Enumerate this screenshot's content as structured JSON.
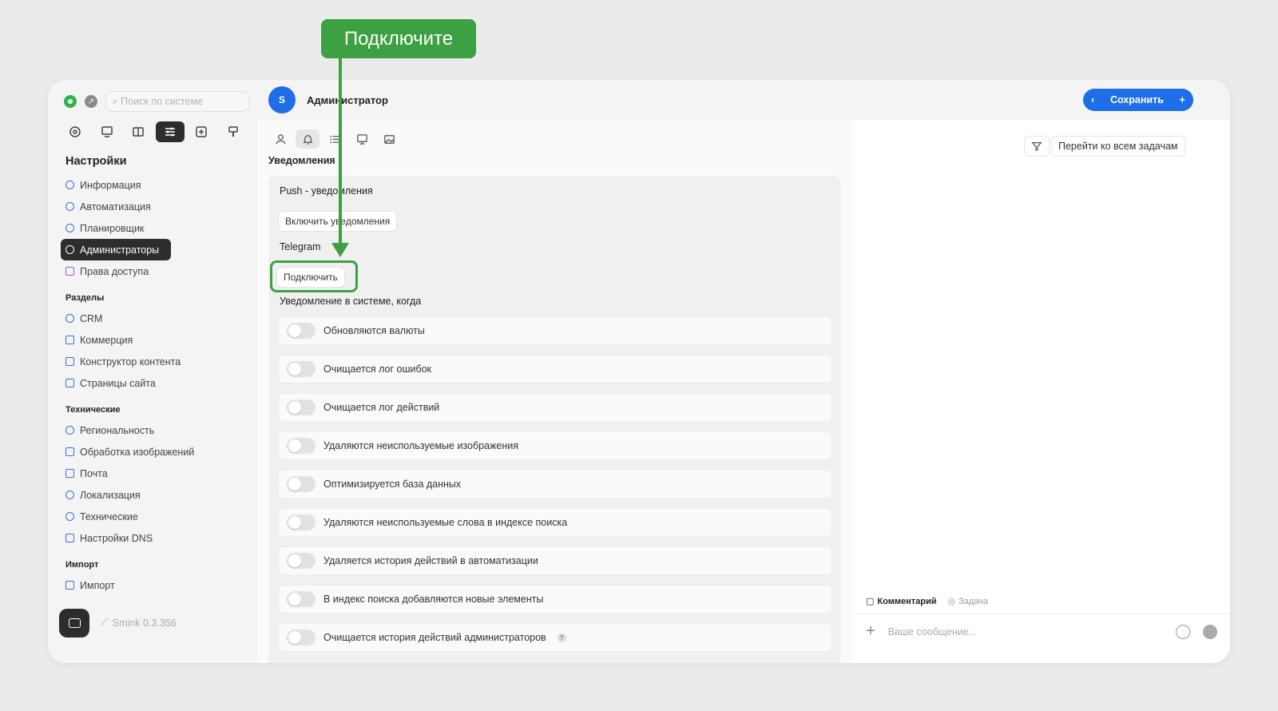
{
  "callout": {
    "text": "Подключите"
  },
  "search": {
    "placeholder": "Поиск по системе"
  },
  "sidebar": {
    "title": "Настройки",
    "settings_items": [
      {
        "label": "Информация"
      },
      {
        "label": "Автоматизация"
      },
      {
        "label": "Планировщик"
      },
      {
        "label": "Администраторы",
        "active": true
      },
      {
        "label": "Права доступа"
      }
    ],
    "sections": [
      {
        "title": "Разделы",
        "items": [
          "CRM",
          "Коммерция",
          "Конструктор контента",
          "Страницы сайта"
        ]
      },
      {
        "title": "Технические",
        "items": [
          "Региональность",
          "Обработка изображений",
          "Почта",
          "Локализация",
          "Технические",
          "Настройки DNS"
        ]
      },
      {
        "title": "Импорт",
        "items": [
          "Импорт"
        ]
      }
    ],
    "version": "Smink 0.3.356"
  },
  "header": {
    "avatar_letter": "S",
    "name": "Администратор",
    "save_label": "Сохранить"
  },
  "main": {
    "section_title": "Уведомления",
    "push_label": "Push - уведомления",
    "enable_button": "Включить уведомления",
    "telegram_label": "Telegram",
    "connect_button": "Подключить",
    "system_label": "Уведомление в системе, когда",
    "toggles": [
      "Обновляются валюты",
      "Очищается лог ошибок",
      "Очищается лог действий",
      "Удаляются неиспользуемые изображения",
      "Оптимизируется база данных",
      "Удаляются неиспользуемые слова в индексе поиска",
      "Удаляется история действий в автоматизации",
      "В индекс поиска добавляются новые элементы",
      "Очищается история действий администраторов"
    ],
    "qmark": "?"
  },
  "right": {
    "tasks_button": "Перейти ко всем задачам",
    "comment_tab": "Комментарий",
    "task_tab": "Задача",
    "message_placeholder": "Ваше сообщение..."
  },
  "colors": {
    "accent_blue": "#1d6ee8",
    "callout_green": "#3da043",
    "dark": "#2d2d2d"
  }
}
